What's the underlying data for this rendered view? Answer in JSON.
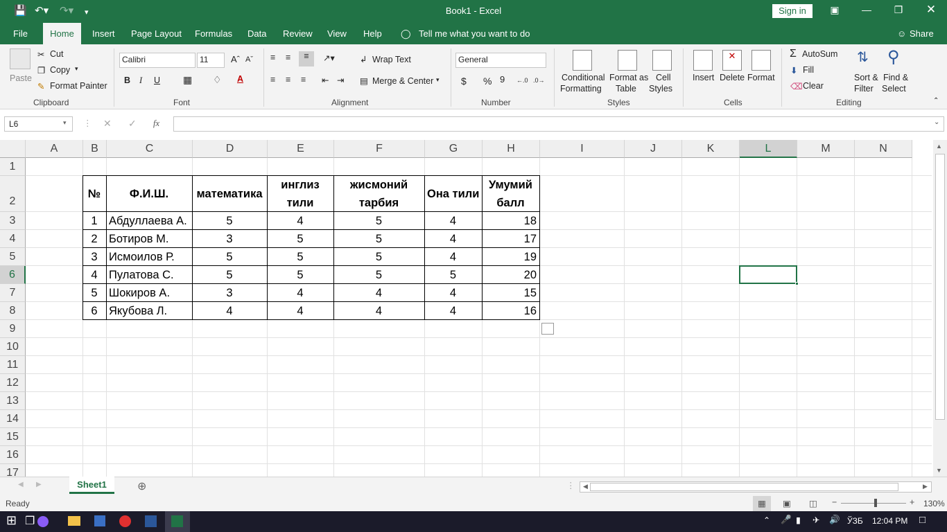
{
  "window": {
    "title": "Book1  -  Excel",
    "sign_in": "Sign in",
    "share": "Share"
  },
  "menu": {
    "file": "File",
    "home": "Home",
    "insert": "Insert",
    "page_layout": "Page Layout",
    "formulas": "Formulas",
    "data": "Data",
    "review": "Review",
    "view": "View",
    "help": "Help",
    "tell_me": "Tell me what you want to do"
  },
  "ribbon": {
    "clipboard": {
      "paste": "Paste",
      "cut": "Cut",
      "copy": "Copy",
      "format_painter": "Format Painter",
      "label": "Clipboard"
    },
    "font": {
      "name": "Calibri",
      "size": "11",
      "bold": "B",
      "italic": "I",
      "underline": "U",
      "label": "Font"
    },
    "alignment": {
      "wrap_text": "Wrap Text",
      "merge_center": "Merge & Center",
      "label": "Alignment"
    },
    "number": {
      "format": "General",
      "currency": "$",
      "percent": "%",
      "comma": "9",
      "label": "Number"
    },
    "styles": {
      "conditional_1": "Conditional",
      "conditional_2": "Formatting",
      "format_table_1": "Format as",
      "format_table_2": "Table",
      "cell_styles_1": "Cell",
      "cell_styles_2": "Styles",
      "label": "Styles"
    },
    "cells": {
      "insert": "Insert",
      "delete": "Delete",
      "format": "Format",
      "label": "Cells"
    },
    "editing": {
      "autosum": "AutoSum",
      "fill": "Fill",
      "clear": "Clear",
      "sort_1": "Sort &",
      "sort_2": "Filter",
      "find_1": "Find &",
      "find_2": "Select",
      "label": "Editing"
    }
  },
  "formula_bar": {
    "name_box": "L6",
    "fx": "fx",
    "value": ""
  },
  "columns": [
    "A",
    "B",
    "C",
    "D",
    "E",
    "F",
    "G",
    "H",
    "I",
    "J",
    "K",
    "L",
    "M",
    "N"
  ],
  "rows": [
    "1",
    "2",
    "3",
    "4",
    "5",
    "6",
    "7",
    "8",
    "9",
    "10",
    "11",
    "12",
    "13",
    "14",
    "15",
    "16",
    "17"
  ],
  "table": {
    "headers": {
      "no": "№",
      "name": "Ф.И.Ш.",
      "math": "математика",
      "eng_1": "инглиз",
      "eng_2": "тили",
      "phys_1": "жисмоний",
      "phys_2": "тарбия",
      "native": "Она тили",
      "total_1": "Умумий",
      "total_2": "балл"
    },
    "rows": [
      {
        "no": "1",
        "name": "Абдуллаева А.",
        "math": "5",
        "eng": "4",
        "phys": "5",
        "native": "4",
        "total": "18"
      },
      {
        "no": "2",
        "name": "Ботиров М.",
        "math": "3",
        "eng": "5",
        "phys": "5",
        "native": "4",
        "total": "17"
      },
      {
        "no": "3",
        "name": "Исмоилов Р.",
        "math": "5",
        "eng": "5",
        "phys": "5",
        "native": "4",
        "total": "19"
      },
      {
        "no": "4",
        "name": "Пулатова С.",
        "math": "5",
        "eng": "5",
        "phys": "5",
        "native": "5",
        "total": "20"
      },
      {
        "no": "5",
        "name": "Шокиров А.",
        "math": "3",
        "eng": "4",
        "phys": "4",
        "native": "4",
        "total": "15"
      },
      {
        "no": "6",
        "name": "Якубова Л.",
        "math": "4",
        "eng": "4",
        "phys": "4",
        "native": "4",
        "total": "16"
      }
    ]
  },
  "sheet_tab": "Sheet1",
  "status": {
    "ready": "Ready",
    "zoom": "130%"
  },
  "taskbar": {
    "lang": "ЎЗБ",
    "time": "12:04 PM"
  },
  "colors": {
    "accent": "#217346",
    "selection": "#217346"
  }
}
